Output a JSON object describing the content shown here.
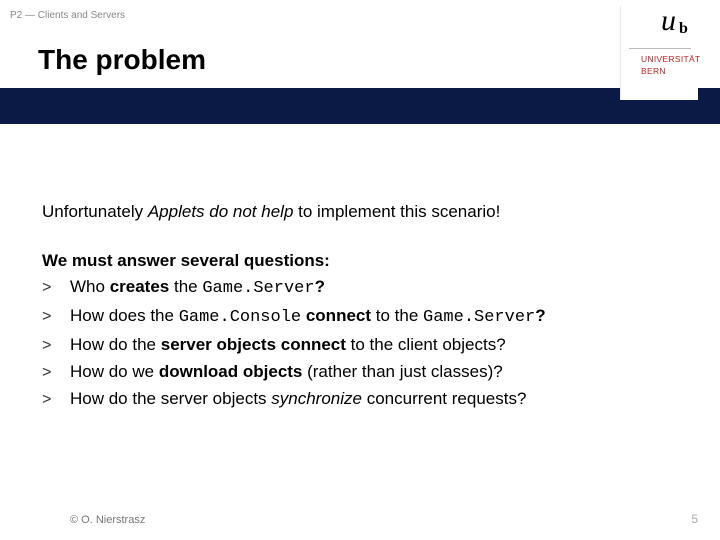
{
  "header": {
    "breadcrumb": "P2 — Clients and Servers",
    "title": "The problem"
  },
  "logo": {
    "u": "u",
    "b": "b",
    "univ": "UNIVERSITÄT",
    "bern": "BERN"
  },
  "body": {
    "lead_pre": "Unfortunately ",
    "lead_em": "Applets do not help",
    "lead_post": " to implement this scenario!",
    "qhead": "We must answer several questions:",
    "bullet": ">",
    "items": [
      {
        "pre": "Who ",
        "b1": "creates",
        "mid1": " the ",
        "m1": "Game.Server",
        "b2": "?",
        "post": ""
      },
      {
        "pre": "How does the ",
        "m1": "Game.Console",
        "mid1": " ",
        "b1": "connect",
        "mid2": " to the ",
        "m2": "Game.Server",
        "b2": "?",
        "post": ""
      },
      {
        "pre": "How do the ",
        "b1": "server objects connect",
        "post": " to the client objects?"
      },
      {
        "pre": "How do we ",
        "b1": "download objects",
        "post": " (rather than just classes)?"
      },
      {
        "pre": "How do the server objects ",
        "i1": "synchronize",
        "post": " concurrent requests?"
      }
    ]
  },
  "footer": {
    "left": "© O. Nierstrasz",
    "right": "5"
  }
}
